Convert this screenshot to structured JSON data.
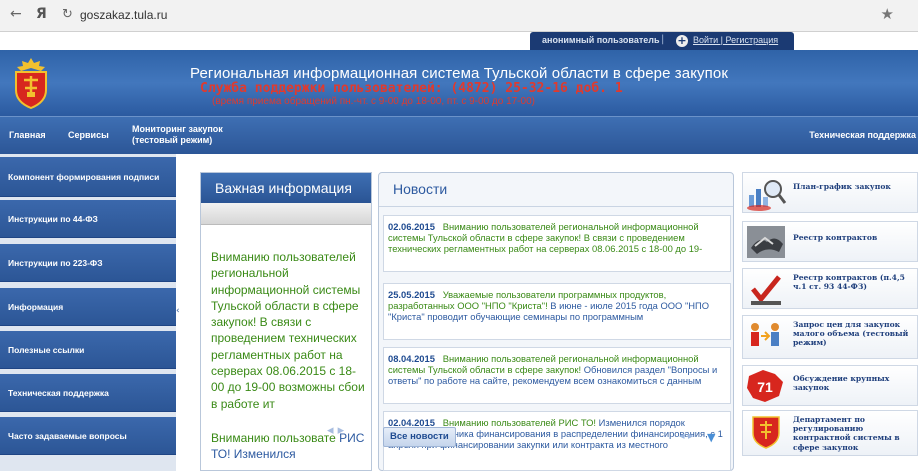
{
  "browser": {
    "back_glyph": "←",
    "yandex_glyph": "Я",
    "reload_glyph": "↻",
    "url": "goszakaz.tula.ru",
    "star_glyph": "★"
  },
  "userbar": {
    "user": "анонимный пользователь",
    "separator": "|",
    "plus_glyph": "+",
    "login": "Войти | Регистрация"
  },
  "header": {
    "title": "Региональная информационная система Тульской области в сфере закупок",
    "support": "Служба поддержки пользователей: (4872) 25-32-16 доб. 1",
    "hours": "(время приема обращений пн.-чт. с 9-00 до 18-00, пт. с 9-00 до 17-00)"
  },
  "mainnav": {
    "home": "Главная",
    "services": "Сервисы",
    "monitoring": "Мониторинг закупок (тестовый режим)",
    "tech_support": "Техническая поддержка"
  },
  "sidebar": {
    "items": [
      {
        "label": "Компонент формирования подписи"
      },
      {
        "label": "Инструкции по 44-ФЗ"
      },
      {
        "label": "Инструкции по 223-ФЗ"
      },
      {
        "label": "Информация"
      },
      {
        "label": "Полезные ссылки"
      },
      {
        "label": "Техническая поддержка"
      },
      {
        "label": "Часто задаваемые вопросы"
      }
    ],
    "collapse_glyph": "‹"
  },
  "important": {
    "title": "Важная информация",
    "text": "Вниманию пользователей региональной информационной системы Тульской области в сфере закупок! В связи с проведением технических регламентных работ на серверах 08.06.2015 с 18-00 до 19-00 возможны сбои в работе ит",
    "text2_prefix": "Вниманию пользовате",
    "text2_link": "РИС ТО! Изменился",
    "arrows": "◂ ▸"
  },
  "news": {
    "title": "Новости",
    "items": [
      {
        "date": "02.06.2015",
        "body": "Вниманию пользователей региональной информационной системы Тульской области в сфере закупок! В связи с проведением технических регламентных работ на серверах 08.06.2015 с 18-00 до 19-",
        "blue": ""
      },
      {
        "date": "25.05.2015",
        "body": "Уважаемые пользователи программных продуктов, разработанных ООО \"НПО \"Криста\"! ",
        "blue": "В июне - июле 2015 года ООО \"НПО \"Криста\" проводит обучающие семинары по программным"
      },
      {
        "date": "08.04.2015",
        "body": "Вниманию пользователей региональной информационной системы Тульской области в сфере закупок! ",
        "blue": "Обновился раздел \"Вопросы и ответы\" по работе на сайте, рекомендуем всем ознакомиться с данным"
      },
      {
        "date": "02.04.2015",
        "body": "Вниманию пользователей РИС ТО! ",
        "blue": "Изменился порядок указания источника финансирования в распределении финансирования, с 1 апреля при финансировании закупки или контракта из местного"
      }
    ],
    "all_news": "Все новости",
    "down_glyph": "▼",
    "dots": "◂ ▸"
  },
  "quick_links": [
    {
      "label": "План-график закупок",
      "icon": "chart-magnifier-icon"
    },
    {
      "label": "Реестр контрактов",
      "icon": "handshake-icon"
    },
    {
      "label": "Реестр контрактов (п.4,5 ч.1 ст. 93 44-ФЗ)",
      "icon": "checkmark-ballot-icon"
    },
    {
      "label": "Запрос цен для закупок малого объема (тестовый режим)",
      "icon": "people-arrows-icon"
    },
    {
      "label": "Обсуждение крупных закупок",
      "icon": "region-71-icon",
      "badge": "71"
    },
    {
      "label": "Департамент по регулированию контрактной системы в сфере закупок",
      "icon": "tula-emblem-icon"
    }
  ],
  "colors": {
    "brand_blue": "#2f63a8",
    "nav_dark": "#2c5696",
    "support_red": "#e03a2e",
    "news_green": "#3a8a16",
    "link_blue": "#2d5aa0"
  }
}
